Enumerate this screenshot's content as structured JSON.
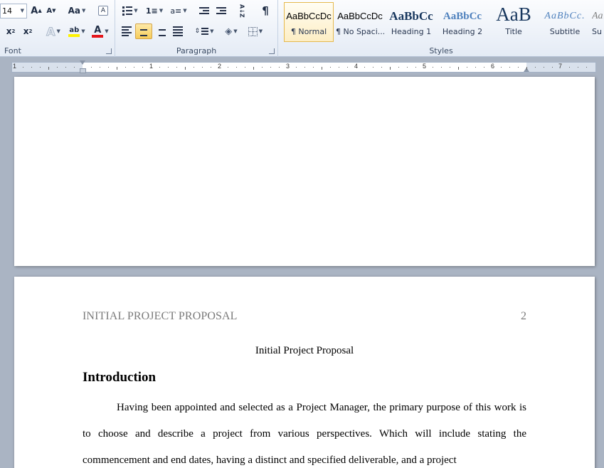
{
  "ribbon": {
    "font": {
      "label": "Font",
      "size_value": "14",
      "grow_label": "A",
      "shrink_label": "A",
      "case_label": "Aa",
      "clear_label": "A",
      "subscript_label": "x",
      "subscript_mark": "2",
      "superscript_label": "x",
      "superscript_mark": "2",
      "effects_label": "A",
      "highlight_label": "ab",
      "color_label": "A",
      "highlight_color": "#fff200",
      "font_color": "#e4161b"
    },
    "paragraph": {
      "label": "Paragraph",
      "sort_label": "A↓Z",
      "marks_label": "¶",
      "numbering_label": "1≡",
      "multilevel_label": "a≡"
    },
    "styles": {
      "label": "Styles",
      "items": [
        {
          "preview": "AaBbCcDc",
          "name": "¶ Normal"
        },
        {
          "preview": "AaBbCcDc",
          "name": "¶ No Spaci..."
        },
        {
          "preview": "AaBbCc",
          "name": "Heading 1"
        },
        {
          "preview": "AaBbCc",
          "name": "Heading 2"
        },
        {
          "preview": "AaB",
          "name": "Title"
        },
        {
          "preview": "AaBbCc.",
          "name": "Subtitle"
        },
        {
          "preview": "AaBbCc",
          "name": "Su"
        }
      ]
    }
  },
  "ruler": {
    "numbers": [
      "1",
      "1",
      "2",
      "3",
      "4",
      "5",
      "6",
      "7"
    ]
  },
  "document": {
    "running_head": "INITIAL PROJECT PROPOSAL",
    "page_number": "2",
    "title": "Initial Project Proposal",
    "heading": "Introduction",
    "body": "Having been appointed and selected as a Project Manager, the primary purpose of this work is to choose and describe a project from various perspectives. Which will include stating the commencement and end dates, having a distinct and specified deliverable, and a project"
  },
  "colors": {
    "heading_blue": "#17365d",
    "heading2_blue": "#4f81bd",
    "selected_style_border": "#e5b94e"
  }
}
